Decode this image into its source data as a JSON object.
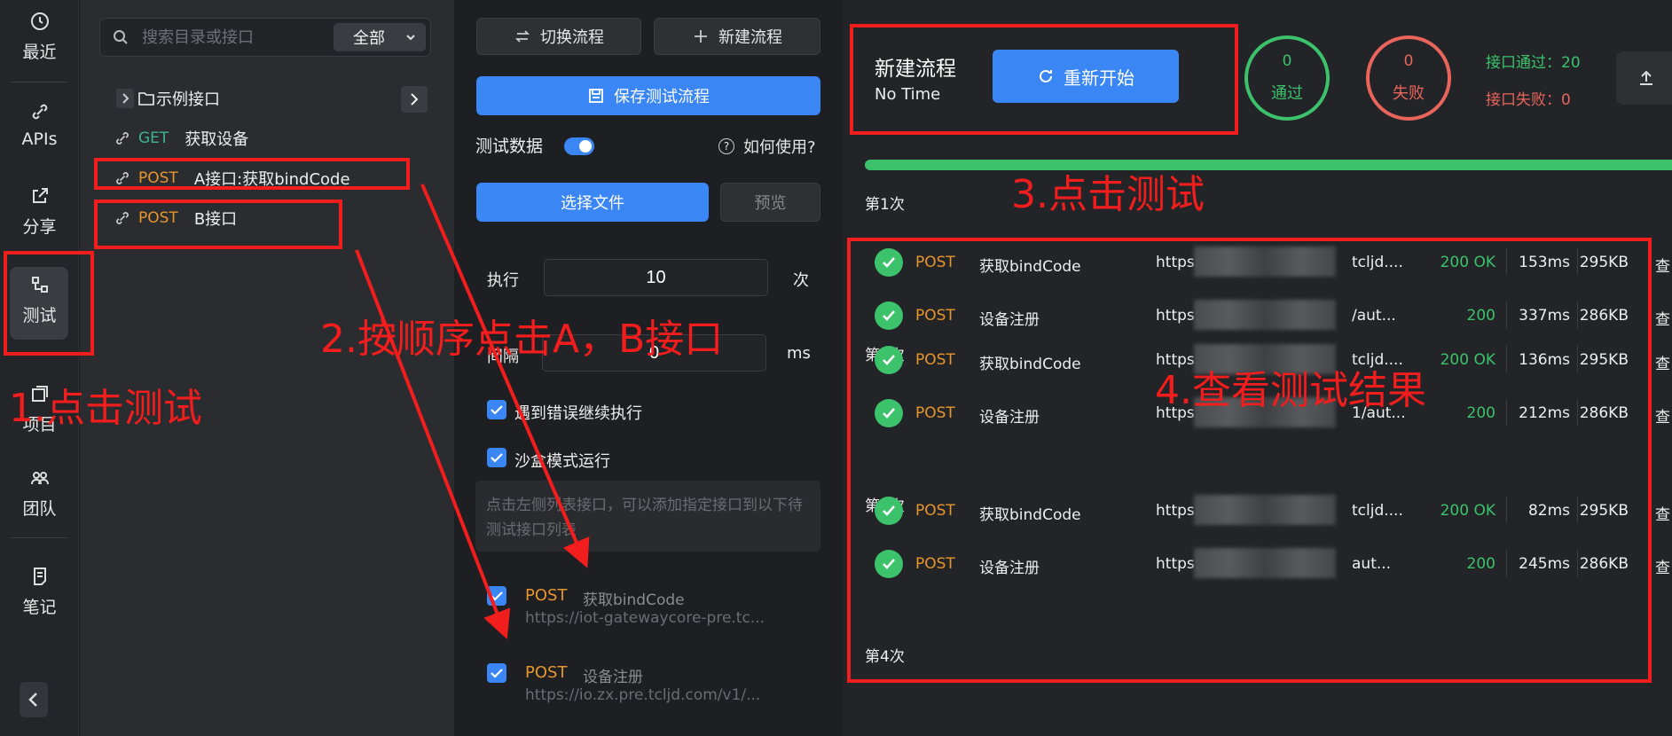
{
  "rail": {
    "items": [
      {
        "label": "最近"
      },
      {
        "label": "APIs"
      },
      {
        "label": "分享"
      },
      {
        "label": "测试"
      },
      {
        "label": "项目"
      },
      {
        "label": "团队"
      },
      {
        "label": "笔记"
      }
    ]
  },
  "tree": {
    "search_placeholder": "搜索目录或接口",
    "scope": "全部",
    "folder": "示例接口",
    "items": [
      {
        "method": "GET",
        "name": "获取设备"
      },
      {
        "method": "POST",
        "name": "A接口:获取bindCode"
      },
      {
        "method": "POST",
        "name": "B接口"
      }
    ]
  },
  "middle": {
    "switch_flow": "切换流程",
    "new_flow": "新建流程",
    "save_flow": "保存测试流程",
    "test_data": "测试数据",
    "how_to": "如何使用?",
    "choose_file": "选择文件",
    "preview": "预览",
    "exec_label": "执行",
    "exec_value": "10",
    "exec_unit": "次",
    "interval_label": "间隔",
    "interval_value": "0",
    "interval_unit": "ms",
    "continue_on_error": "遇到错误继续执行",
    "sandbox": "沙盒模式运行",
    "hint": "点击左侧列表接口，可以添加指定接口到以下待测试接口列表",
    "selected": [
      {
        "method": "POST",
        "name": "获取bindCode",
        "url": "https://iot-gatewaycore-pre.tc..."
      },
      {
        "method": "POST",
        "name": "设备注册",
        "url": "https://io.zx.pre.tcljd.com/v1/..."
      }
    ]
  },
  "right": {
    "flow_name": "新建流程",
    "flow_time": "No Time",
    "restart": "重新开始",
    "pass_count": "0",
    "pass_label": "通过",
    "fail_count": "0",
    "fail_label": "失败",
    "api_pass": "接口通过：20",
    "api_fail": "接口失败：0",
    "progress": 1.0,
    "rounds": [
      {
        "label": "第1次",
        "rows": [
          {
            "method": "POST",
            "name": "获取bindCode",
            "url": "https:",
            "url_tail": "tcljd....",
            "status": "200 OK",
            "time": "153ms",
            "size": "295KB",
            "view": "查"
          },
          {
            "method": "POST",
            "name": "设备注册",
            "url": "https://i",
            "url_tail": "/aut...",
            "status": "200",
            "time": "337ms",
            "size": "286KB",
            "view": "查"
          }
        ]
      },
      {
        "label": "第2次",
        "rows": [
          {
            "method": "POST",
            "name": "获取bindCode",
            "url": "https://i",
            "url_tail": "tcljd....",
            "status": "200 OK",
            "time": "136ms",
            "size": "295KB",
            "view": "查"
          },
          {
            "method": "POST",
            "name": "设备注册",
            "url": "https://i",
            "url_tail": "1/aut...",
            "status": "200",
            "time": "212ms",
            "size": "286KB",
            "view": "查"
          }
        ]
      },
      {
        "label": "第3次",
        "rows": [
          {
            "method": "POST",
            "name": "获取bindCode",
            "url": "https://",
            "url_tail": "tcljd....",
            "status": "200 OK",
            "time": "82ms",
            "size": "295KB",
            "view": "查"
          },
          {
            "method": "POST",
            "name": "设备注册",
            "url": "https://i",
            "url_tail": "aut...",
            "status": "200",
            "time": "245ms",
            "size": "286KB",
            "view": "查"
          }
        ]
      },
      {
        "label": "第4次",
        "rows": []
      }
    ]
  },
  "annotations": {
    "step1": "1.点击测试",
    "step2": "2.按顺序点击A，B接口",
    "step3": "3.点击测试",
    "step4": "4.查看测试结果",
    "color": "#f21d1d"
  },
  "colors": {
    "accent": "#3a86f5",
    "success": "#3cc26b",
    "danger": "#e9655b",
    "post": "#e7962d",
    "get": "#3fb48f"
  }
}
